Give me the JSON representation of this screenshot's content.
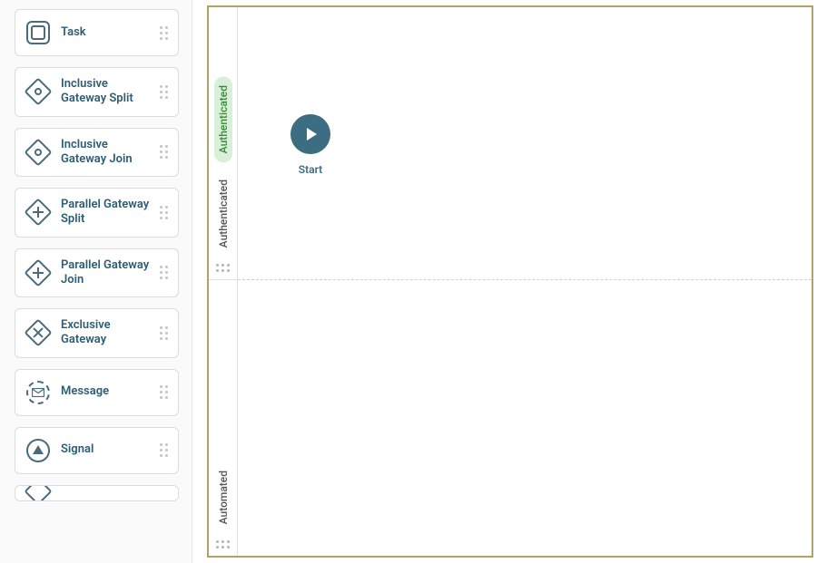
{
  "palette": {
    "items": [
      {
        "id": "task",
        "label": "Task",
        "icon": "task"
      },
      {
        "id": "inclusive-split",
        "label": "Inclusive Gateway Split",
        "icon": "diamond-circle"
      },
      {
        "id": "inclusive-join",
        "label": "Inclusive Gateway Join",
        "icon": "diamond-circle"
      },
      {
        "id": "parallel-split",
        "label": "Parallel Gateway Split",
        "icon": "diamond-plus"
      },
      {
        "id": "parallel-join",
        "label": "Parallel Gateway Join",
        "icon": "diamond-plus"
      },
      {
        "id": "exclusive",
        "label": "Exclusive Gateway",
        "icon": "diamond-x"
      },
      {
        "id": "message",
        "label": "Message",
        "icon": "message"
      },
      {
        "id": "signal",
        "label": "Signal",
        "icon": "signal"
      }
    ]
  },
  "canvas": {
    "lanes": [
      {
        "id": "authenticated",
        "label": "Authenticated",
        "highlight": true
      },
      {
        "id": "automated",
        "label": "Automated",
        "highlight": false
      }
    ],
    "start_node": {
      "label": "Start"
    }
  }
}
